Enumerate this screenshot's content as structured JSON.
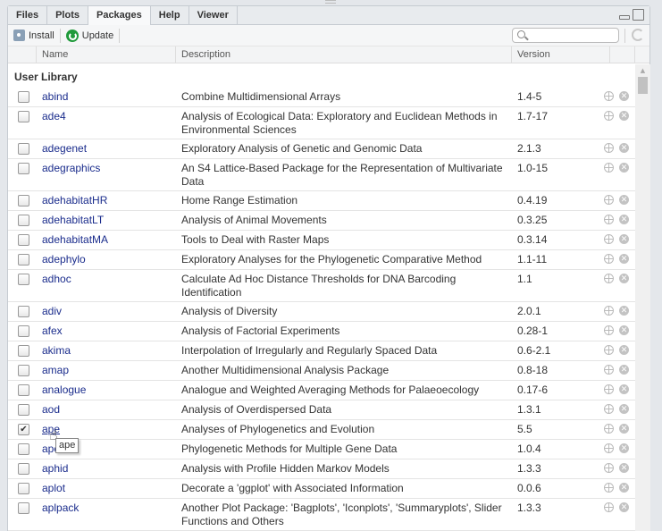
{
  "tabs": [
    {
      "label": "Files"
    },
    {
      "label": "Plots"
    },
    {
      "label": "Packages",
      "active": true
    },
    {
      "label": "Help"
    },
    {
      "label": "Viewer"
    }
  ],
  "toolbar": {
    "install": "Install",
    "update": "Update",
    "search_placeholder": ""
  },
  "columns": {
    "name": "Name",
    "description": "Description",
    "version": "Version"
  },
  "library_label": "User Library",
  "tooltip": "ape",
  "packages": [
    {
      "name": "abind",
      "description": "Combine Multidimensional Arrays",
      "version": "1.4-5",
      "checked": false
    },
    {
      "name": "ade4",
      "description": "Analysis of Ecological Data: Exploratory and Euclidean Methods in Environmental Sciences",
      "version": "1.7-17",
      "checked": false
    },
    {
      "name": "adegenet",
      "description": "Exploratory Analysis of Genetic and Genomic Data",
      "version": "2.1.3",
      "checked": false
    },
    {
      "name": "adegraphics",
      "description": "An S4 Lattice-Based Package for the Representation of Multivariate Data",
      "version": "1.0-15",
      "checked": false
    },
    {
      "name": "adehabitatHR",
      "description": "Home Range Estimation",
      "version": "0.4.19",
      "checked": false
    },
    {
      "name": "adehabitatLT",
      "description": "Analysis of Animal Movements",
      "version": "0.3.25",
      "checked": false
    },
    {
      "name": "adehabitatMA",
      "description": "Tools to Deal with Raster Maps",
      "version": "0.3.14",
      "checked": false
    },
    {
      "name": "adephylo",
      "description": "Exploratory Analyses for the Phylogenetic Comparative Method",
      "version": "1.1-11",
      "checked": false
    },
    {
      "name": "adhoc",
      "description": "Calculate Ad Hoc Distance Thresholds for DNA Barcoding Identification",
      "version": "1.1",
      "checked": false
    },
    {
      "name": "adiv",
      "description": "Analysis of Diversity",
      "version": "2.0.1",
      "checked": false
    },
    {
      "name": "afex",
      "description": "Analysis of Factorial Experiments",
      "version": "0.28-1",
      "checked": false
    },
    {
      "name": "akima",
      "description": "Interpolation of Irregularly and Regularly Spaced Data",
      "version": "0.6-2.1",
      "checked": false
    },
    {
      "name": "amap",
      "description": "Another Multidimensional Analysis Package",
      "version": "0.8-18",
      "checked": false
    },
    {
      "name": "analogue",
      "description": "Analogue and Weighted Averaging Methods for Palaeoecology",
      "version": "0.17-6",
      "checked": false
    },
    {
      "name": "aod",
      "description": "Analysis of Overdispersed Data",
      "version": "1.3.1",
      "checked": false
    },
    {
      "name": "ape",
      "description": "Analyses of Phylogenetics and Evolution",
      "version": "5.5",
      "checked": true
    },
    {
      "name": "apex",
      "description": "Phylogenetic Methods for Multiple Gene Data",
      "version": "1.0.4",
      "checked": false
    },
    {
      "name": "aphid",
      "description": "Analysis with Profile Hidden Markov Models",
      "version": "1.3.3",
      "checked": false
    },
    {
      "name": "aplot",
      "description": "Decorate a 'ggplot' with Associated Information",
      "version": "0.0.6",
      "checked": false
    },
    {
      "name": "aplpack",
      "description": "Another Plot Package: 'Bagplots', 'Iconplots', 'Summaryplots', Slider Functions and Others",
      "version": "1.3.3",
      "checked": false
    }
  ]
}
